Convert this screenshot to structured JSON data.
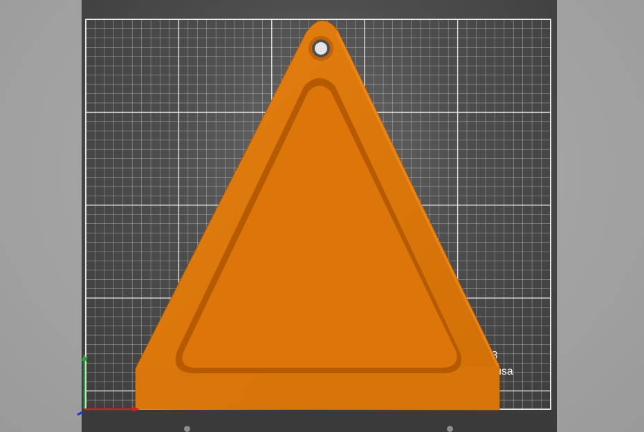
{
  "viewport": {
    "background_color": "#a3a3a3",
    "bed_color": "#4a4a4a",
    "grid_color": "#ffffff",
    "model_color": "#e07a10",
    "model_shade_color": "#b85c00"
  },
  "bed": {
    "label_line1": "K3",
    "label_line2": "Prusa"
  },
  "model": {
    "name": "triangle-sign-model"
  },
  "axes": {
    "x_color": "#cc2222",
    "y_color": "#22aa33",
    "z_color": "#2233cc"
  }
}
